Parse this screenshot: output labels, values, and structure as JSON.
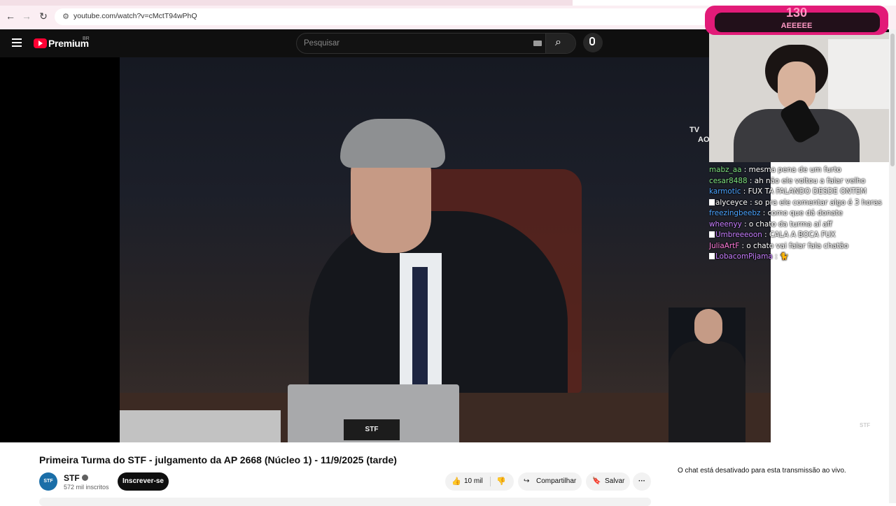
{
  "browser": {
    "url": "youtube.com/watch?v=cMctT94wPhQ",
    "back_icon": "←",
    "forward_icon": "→",
    "reload_icon": "↻",
    "site_info_icon": "⚙"
  },
  "header": {
    "logo_text": "Premium",
    "logo_region": "BR",
    "search_placeholder": "Pesquisar",
    "search_icon": "⌕",
    "mic_icon": "🎤"
  },
  "video_overlay": {
    "tv_logo_text": "TV",
    "tv_logo_text2": "AO",
    "desk_logo": "STF",
    "watermark": "STF"
  },
  "stream_overlay": {
    "count": "130",
    "label": "AEEEEE"
  },
  "chat_messages": [
    {
      "user": "mabz_aa",
      "color": "#7fe37f",
      "text": "mesma pena de um furto",
      "icon": false
    },
    {
      "user": "cesar8488",
      "color": "#7fe37f",
      "text": "ah não ele voltou a falar velho",
      "icon": false
    },
    {
      "user": "karmotic",
      "color": "#4aa3ff",
      "text": "FUX TA FALANDO DESDE ONTEM",
      "icon": false
    },
    {
      "user": "alyceyce",
      "color": "#ffffff",
      "text": "so pra ele comentar algo é 3 horas",
      "icon": true
    },
    {
      "user": "freezingbeebz",
      "color": "#4aa3ff",
      "text": "como que dá donate",
      "icon": false
    },
    {
      "user": "wheenyy",
      "color": "#c77dff",
      "text": "o chato da turma aí aff",
      "icon": false
    },
    {
      "user": "Umbreeeoon",
      "color": "#c77dff",
      "text": "CALA A BOCA FUX",
      "icon": true
    },
    {
      "user": "JuliaArtF",
      "color": "#ff7ad9",
      "text": "o chato vai falar fala chatão",
      "icon": false
    },
    {
      "user": "LobacomPijama",
      "color": "#c77dff",
      "text": "🐈",
      "icon": true
    }
  ],
  "video_info": {
    "title": "Primeira Turma do STF - julgamento da AP 2668 (Núcleo 1) - 11/9/2025 (tarde)",
    "channel_name": "STF",
    "channel_avatar_text": "STF",
    "subscribers": "572 mil inscritos",
    "subscribe_label": "Inscrever-se",
    "like_count": "10 mil",
    "like_icon": "👍",
    "dislike_icon": "👎",
    "share_label": "Compartilhar",
    "share_icon": "↪",
    "save_label": "Salvar",
    "save_icon": "🔖",
    "more_label": "···"
  },
  "side_panel": {
    "chat_disabled_text": "O chat está desativado para esta transmissão ao vivo."
  }
}
